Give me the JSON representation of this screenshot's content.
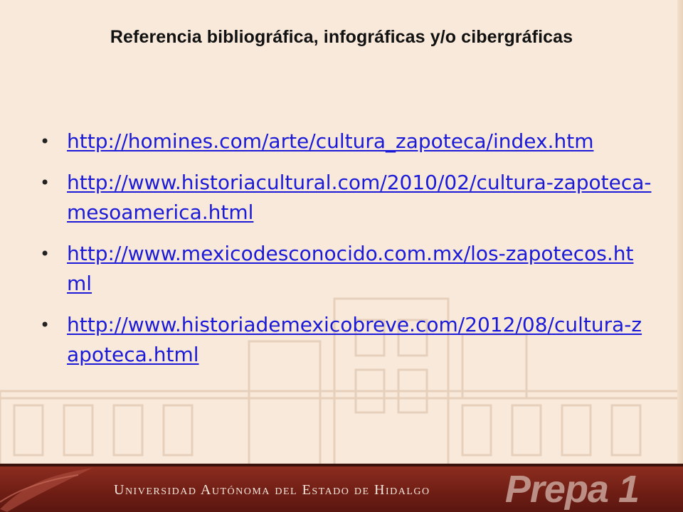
{
  "slide": {
    "title": "Referencia bibliográfica, infográficas y/o cibergráficas",
    "links": [
      "http://homines.com/arte/cultura_zapoteca/index.htm",
      "http://www.historiacultural.com/2010/02/cultura-zapoteca-mesoamerica.html",
      "http://www.mexicodesconocido.com.mx/los-zapotecos.html",
      "http://www.historiademexicobreve.com/2012/08/cultura-zapoteca.html"
    ],
    "bullet": "•"
  },
  "footer": {
    "institution": "Universidad Autónoma del Estado de Hidalgo",
    "logo": "Prepa 1"
  },
  "colors": {
    "background": "#f8e9da",
    "link": "#1a1ad8",
    "footer": "#7a2418"
  }
}
